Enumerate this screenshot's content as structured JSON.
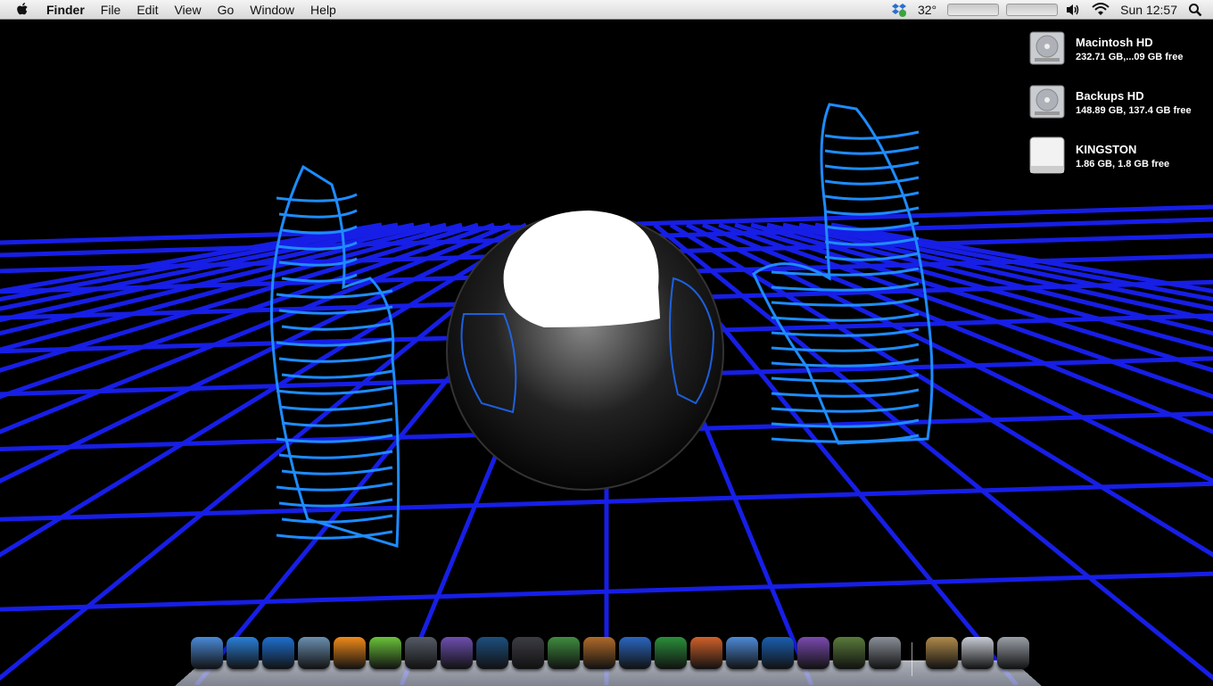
{
  "menubar": {
    "app_name": "Finder",
    "items": [
      "File",
      "Edit",
      "View",
      "Go",
      "Window",
      "Help"
    ],
    "weather": "32°",
    "clock": "Sun 12:57"
  },
  "desktop_drives": [
    {
      "name": "Macintosh HD",
      "info": "232.71 GB,...09 GB free"
    },
    {
      "name": "Backups HD",
      "info": "148.89 GB, 137.4 GB free"
    },
    {
      "name": "KINGSTON",
      "info": "1.86 GB, 1.8 GB free"
    }
  ],
  "dock": {
    "apps": [
      {
        "name": "finder-icon",
        "color": "#4a8ad8"
      },
      {
        "name": "safari-icon",
        "color": "#2a7fd8"
      },
      {
        "name": "itunes-icon",
        "color": "#1e6fd0"
      },
      {
        "name": "preview-icon",
        "color": "#6a8fb0"
      },
      {
        "name": "vlc-icon",
        "color": "#f08a1a"
      },
      {
        "name": "spotify-icon",
        "color": "#6ac23a"
      },
      {
        "name": "disk-utility-icon",
        "color": "#555b66"
      },
      {
        "name": "imovie-icon",
        "color": "#6d4fb0"
      },
      {
        "name": "photoshop-icon",
        "color": "#1d4f7f"
      },
      {
        "name": "aperture-icon",
        "color": "#3c3c44"
      },
      {
        "name": "numbers-icon",
        "color": "#3f8c3f"
      },
      {
        "name": "keynote-icon",
        "color": "#b06a2a"
      },
      {
        "name": "word-icon",
        "color": "#2a66c0"
      },
      {
        "name": "excel-icon",
        "color": "#2a8f3a"
      },
      {
        "name": "powerpoint-icon",
        "color": "#d0602a"
      },
      {
        "name": "xcode-icon",
        "color": "#4d8ad8"
      },
      {
        "name": "wunderlist-icon",
        "color": "#1a5fb0"
      },
      {
        "name": "torrent-icon",
        "color": "#7a4ab0"
      },
      {
        "name": "game-icon",
        "color": "#5a7a3a"
      },
      {
        "name": "system-preferences-icon",
        "color": "#8a8f98"
      },
      {
        "name": "address-book-icon",
        "color": "#b08a4a"
      },
      {
        "name": "downloads-stack-icon",
        "color": "#c8ccd4"
      },
      {
        "name": "trash-icon",
        "color": "#9aa0a8"
      }
    ]
  }
}
